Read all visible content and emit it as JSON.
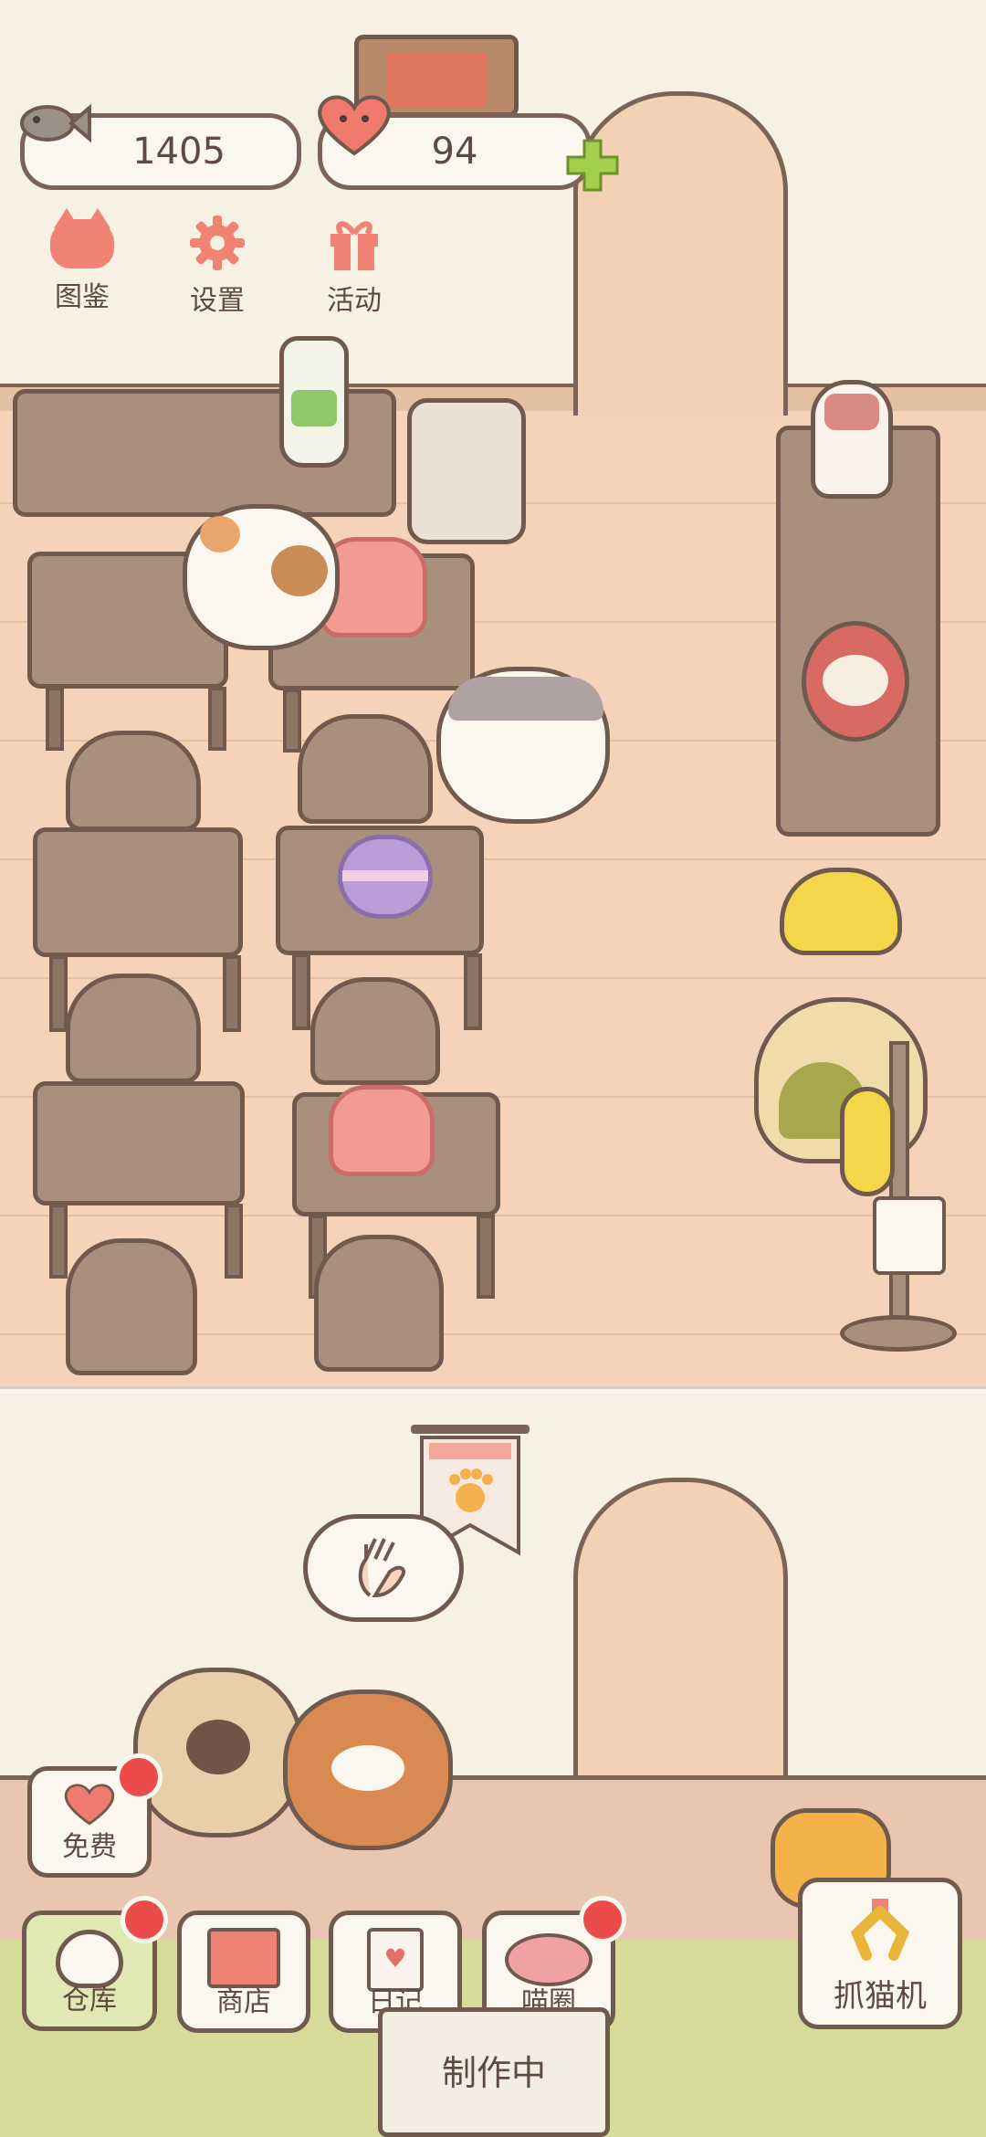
{
  "currency": {
    "fish_count": "1405",
    "heart_count": "94"
  },
  "menu": [
    {
      "label": "图鉴",
      "icon": "cat-head-icon"
    },
    {
      "label": "设置",
      "icon": "gear-icon"
    },
    {
      "label": "活动",
      "icon": "gift-icon"
    }
  ],
  "bottom_bar": {
    "free": "免费",
    "warehouse": "仓库",
    "shop": "商店",
    "diary": "日记",
    "circle": "喵圈",
    "claw_machine": "抓猫机",
    "crafting": "制作中"
  },
  "colors": {
    "badge": "#ec4b4b",
    "plus": "#a3cf4f",
    "heart": "#f07a6e"
  }
}
